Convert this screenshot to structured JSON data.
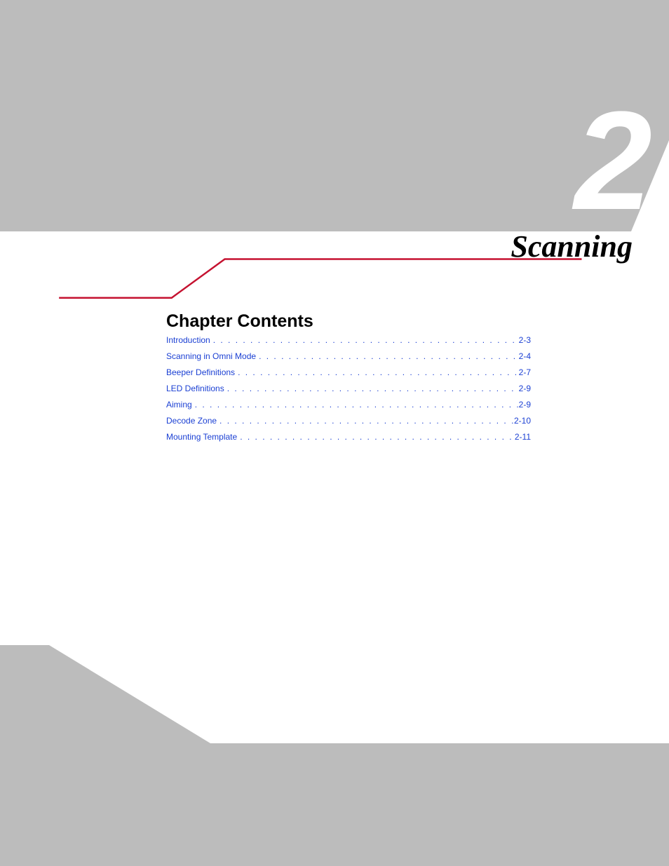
{
  "chapter": {
    "number": "2",
    "title": "Scanning",
    "contents_heading": "Chapter Contents"
  },
  "toc": [
    {
      "title": "Introduction",
      "page": "2-3"
    },
    {
      "title": "Scanning in Omni Mode",
      "page": "2-4"
    },
    {
      "title": "Beeper Definitions",
      "page": "2-7"
    },
    {
      "title": "LED Definitions",
      "page": "2-9"
    },
    {
      "title": "Aiming",
      "page": "2-9"
    },
    {
      "title": "Decode Zone",
      "page": "2-10"
    },
    {
      "title": "Mounting Template",
      "page": "2-11"
    }
  ],
  "colors": {
    "gray": "#bcbcbc",
    "red": "#c51230",
    "link": "#1a3fd3"
  }
}
